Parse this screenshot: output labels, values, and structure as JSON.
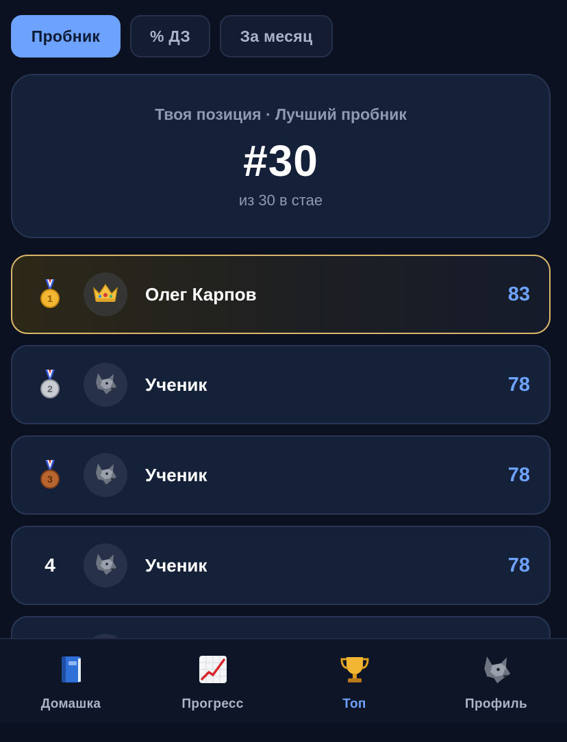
{
  "tabs": [
    {
      "label": "Пробник",
      "active": true
    },
    {
      "label": "% ДЗ",
      "active": false
    },
    {
      "label": "За месяц",
      "active": false
    }
  ],
  "position": {
    "label": "Твоя позиция · Лучший пробник",
    "rank": "#30",
    "sub": "из 30 в стае"
  },
  "leaderboard": [
    {
      "rank": "",
      "rank_icon": "gold-medal-icon",
      "avatar_icon": "crown-icon",
      "name": "Олег Карпов",
      "score": "83"
    },
    {
      "rank": "",
      "rank_icon": "silver-medal-icon",
      "avatar_icon": "wolf-icon",
      "name": "Ученик",
      "score": "78"
    },
    {
      "rank": "",
      "rank_icon": "bronze-medal-icon",
      "avatar_icon": "wolf-icon",
      "name": "Ученик",
      "score": "78"
    },
    {
      "rank": "4",
      "rank_icon": "",
      "avatar_icon": "wolf-icon",
      "name": "Ученик",
      "score": "78"
    }
  ],
  "nav": [
    {
      "label": "Домашка",
      "icon": "book-icon",
      "active": false
    },
    {
      "label": "Прогресс",
      "icon": "chart-up-icon",
      "active": false
    },
    {
      "label": "Топ",
      "icon": "trophy-icon",
      "active": true
    },
    {
      "label": "Профиль",
      "icon": "wolf-icon",
      "active": false
    }
  ],
  "colors": {
    "background": "#0b1120",
    "card": "#152039",
    "accent": "#6ea2ff",
    "gold_border": "#d9b66a",
    "muted_text": "#8e9ab2"
  }
}
